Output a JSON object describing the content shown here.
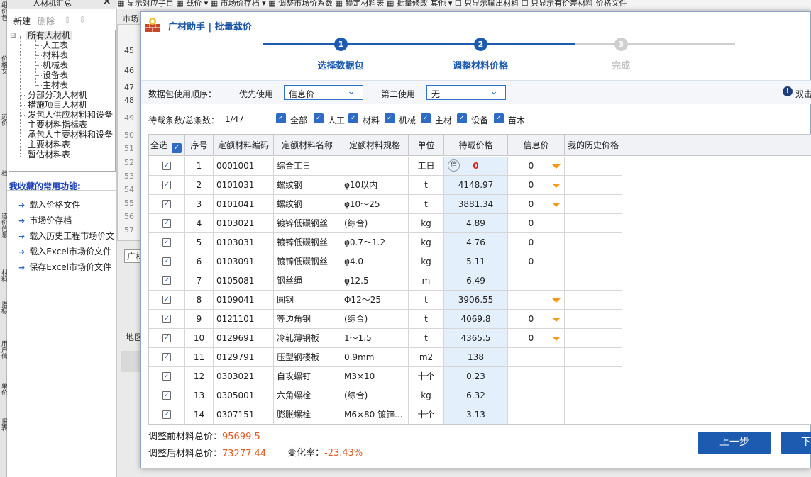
{
  "vstrip": [
    "组价包",
    "价格文",
    "运价",
    "档",
    "造价信息",
    "材料",
    "指标",
    "用户信",
    "单价",
    "报表"
  ],
  "left_panel": {
    "title": "人材机汇总",
    "close": "✕",
    "new_label": "新建",
    "delete_label": "删除",
    "up_label": "⇧",
    "down_label": "⇩",
    "tree": {
      "root": "所有人材机",
      "children": [
        "人工表",
        "材料表",
        "机械表",
        "设备表",
        "主材表"
      ],
      "others": [
        "分部分项人材机",
        "措施项目人材机",
        "发包人供应材料和设备",
        "主要材料指标表",
        "承包人主要材料和设备",
        "主要材料表",
        "暂估材料表"
      ]
    },
    "fav_title": "我收藏的常用功能:",
    "favorites": [
      "载入价格文件",
      "市场价存档",
      "载入历史工程市场价文",
      "载入Excel市场价文件",
      "保存Excel市场价文件"
    ]
  },
  "bg": {
    "topbar_text": "▦ 显示对应子目   ▦ 载价 ▾   ▦ 市场价存档 ▾   ▦ 调整市场价系数   ▦ 锁定材料表   ▦ 批量修改   其他 ▾   ☐ 只显示输出材料   ☐ 只显示有价差材料   价格文件",
    "market_label": "市场",
    "row_numbers": [
      "45",
      "46",
      "47",
      "48",
      "49",
      "50",
      "51",
      "52",
      "53",
      "54",
      "55",
      "56",
      "57"
    ],
    "tab_label": "广材",
    "region_label": "地区"
  },
  "modal": {
    "title": "广材助手 | 批量载价",
    "steps": [
      {
        "num": "1",
        "label": "选择数据包"
      },
      {
        "num": "2",
        "label": "调整材料价格"
      },
      {
        "num": "3",
        "label": "完成"
      }
    ],
    "usage_order_label": "数据包使用顺序：",
    "first_use_label": "优先使用",
    "first_use_value": "信息价",
    "second_use_label": "第二使用",
    "second_use_value": "无",
    "right_hint": "双击",
    "count_label": "待载条数/总条数：",
    "count_value": "1/47",
    "filters": [
      "全部",
      "人工",
      "材料",
      "机械",
      "主材",
      "设备",
      "苗木"
    ],
    "table": {
      "select_all": "全选",
      "headers": [
        "序号",
        "定额材料编码",
        "定额材料名称",
        "定额材料规格",
        "单位",
        "待载价格",
        "信息价",
        "我的历史价格"
      ],
      "rows": [
        {
          "no": "1",
          "code": "0001001",
          "name": "综合工日",
          "spec": "",
          "unit": "工日",
          "price": "0",
          "info": "0",
          "tri": true,
          "tag": "信"
        },
        {
          "no": "2",
          "code": "0101031",
          "name": "螺纹钢",
          "spec": "φ10以内",
          "unit": "t",
          "price": "4148.97",
          "info": "0",
          "tri": true
        },
        {
          "no": "3",
          "code": "0101041",
          "name": "螺纹钢",
          "spec": "φ10～25",
          "unit": "t",
          "price": "3881.34",
          "info": "0",
          "tri": true
        },
        {
          "no": "4",
          "code": "0103021",
          "name": "镀锌低碳钢丝",
          "spec": "(综合)",
          "unit": "kg",
          "price": "4.89",
          "info": "0",
          "tri": false
        },
        {
          "no": "5",
          "code": "0103031",
          "name": "镀锌低碳钢丝",
          "spec": "φ0.7～1.2",
          "unit": "kg",
          "price": "4.76",
          "info": "0",
          "tri": false
        },
        {
          "no": "6",
          "code": "0103091",
          "name": "镀锌低碳钢丝",
          "spec": "φ4.0",
          "unit": "kg",
          "price": "5.11",
          "info": "0",
          "tri": false
        },
        {
          "no": "7",
          "code": "0105081",
          "name": "钢丝绳",
          "spec": "φ12.5",
          "unit": "m",
          "price": "6.49",
          "info": "",
          "tri": false
        },
        {
          "no": "8",
          "code": "0109041",
          "name": "圆钢",
          "spec": "Φ12～25",
          "unit": "t",
          "price": "3906.55",
          "info": "",
          "tri": true
        },
        {
          "no": "9",
          "code": "0121101",
          "name": "等边角钢",
          "spec": "(综合)",
          "unit": "t",
          "price": "4069.8",
          "info": "0",
          "tri": true
        },
        {
          "no": "10",
          "code": "0129691",
          "name": "冷轧薄钢板",
          "spec": "1～1.5",
          "unit": "t",
          "price": "4365.5",
          "info": "0",
          "tri": true
        },
        {
          "no": "11",
          "code": "0129791",
          "name": "压型钢楼板",
          "spec": "0.9mm",
          "unit": "m2",
          "price": "138",
          "info": "",
          "tri": false
        },
        {
          "no": "12",
          "code": "0303021",
          "name": "自攻螺钉",
          "spec": "M3×10",
          "unit": "十个",
          "price": "0.23",
          "info": "",
          "tri": false
        },
        {
          "no": "13",
          "code": "0305001",
          "name": "六角螺栓",
          "spec": "(综合)",
          "unit": "kg",
          "price": "6.32",
          "info": "",
          "tri": false
        },
        {
          "no": "14",
          "code": "0307151",
          "name": "膨胀螺栓",
          "spec": "M6×80 镀锌...",
          "unit": "十个",
          "price": "3.13",
          "info": "",
          "tri": false
        }
      ]
    },
    "before_label": "调整前材料总价：",
    "before_value": "95699.5",
    "after_label": "调整后材料总价：",
    "after_value": "73277.44",
    "change_label": "变化率：",
    "change_value": "-23.43%",
    "prev_button": "上一步",
    "next_button": "下"
  },
  "colors": {
    "accent": "#1c5bb0",
    "checkbox": "#2d6bc4",
    "price_bg": "#e3effb",
    "triangle": "#f39a1a",
    "value_red": "#e05a20"
  }
}
